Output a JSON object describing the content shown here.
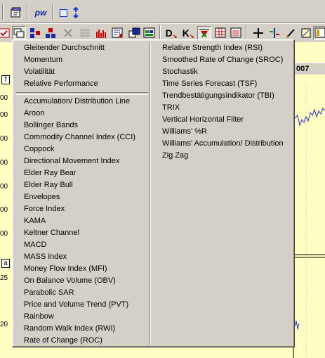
{
  "toolbar_top": {
    "buttons": [
      {
        "name": "properties-icon"
      },
      {
        "name": "pw-logo",
        "label": "pw"
      },
      {
        "name": "square-icon"
      },
      {
        "name": "sync-arrows-icon"
      }
    ]
  },
  "toolbar_main": {
    "buttons": [
      "checkmark-window-icon",
      "window-stack-icon",
      "chart-blocks-icon",
      "chart-blocks-alt-icon",
      "tools-disabled-icon",
      "grid-disabled-icon",
      "bar-chart-red-icon",
      "list-x-icon",
      "windows-cascade-icon",
      "windows-tile-icon",
      "d-cursor-icon",
      "k-cursor-icon",
      "zigzag-icon",
      "chart-grid-icon",
      "table-icon",
      "crosshair-icon",
      "arrows-icon",
      "pencil-icon",
      "panel-icon"
    ],
    "d_label": "D",
    "k_label": "K"
  },
  "chart": {
    "year_label": "007",
    "y_ticks": [
      ":00",
      "00",
      "00",
      "00",
      "00",
      "00",
      "00",
      "00",
      "25",
      "20"
    ],
    "left_markers": [
      "f",
      "a"
    ],
    "colors": {
      "background": "#ffffc4",
      "line": "#2030c0"
    }
  },
  "menu": {
    "left_top": [
      "Gleitender Durchschnitt",
      "Momentum",
      "Volatilität",
      "Relative Performance"
    ],
    "left_bottom": [
      "Accumulation/ Distribution Line",
      "Aroon",
      "Bollinger Bands",
      "Commodity Channel Index (CCI)",
      "Coppock",
      "Directional Movement Index",
      "Elder Ray Bear",
      "Elder Ray Bull",
      "Envelopes",
      "Force Index",
      "KAMA",
      "Keltner Channel",
      "MACD",
      "MASS Index",
      "Money Flow Index (MFI)",
      "On Balance Volume (OBV)",
      "Parabolic SAR",
      "Price and Volume Trend (PVT)",
      "Rainbow",
      "Random Walk Index (RWI)",
      "Rate of Change (ROC)"
    ],
    "right": [
      "Relative Strength Index (RSI)",
      "Smoothed Rate of Change (SROC)",
      "Stochastik",
      "Time Series Forecast (TSF)",
      "Trendbestätigungsindikator (TBI)",
      "TRIX",
      "Vertical Horizontal Filter",
      "Williams' %R",
      "Williams' Accumulation/ Distribution",
      "Zig Zag"
    ]
  }
}
